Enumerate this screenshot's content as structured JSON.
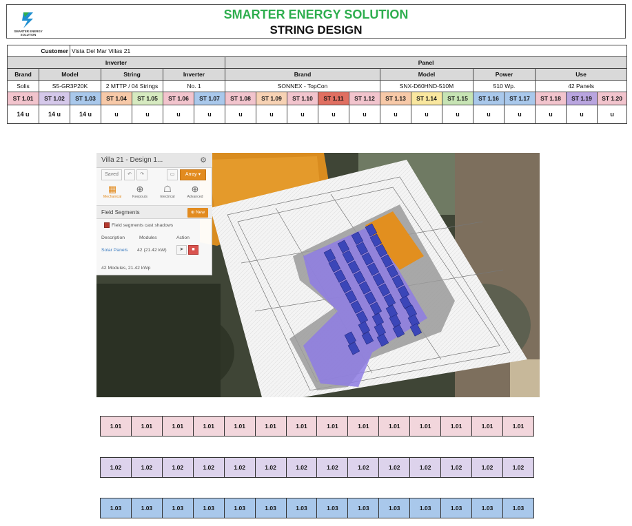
{
  "header": {
    "logo_text": "SMARTER ENERGY SOLUTION",
    "company": "SMARTER ENERGY SOLUTION",
    "title": "STRING DESIGN"
  },
  "customer": {
    "label": "Customer",
    "value": "Vista Del Mar Villas 21"
  },
  "sections": {
    "inverter": "Inverter",
    "panel": "Panel"
  },
  "columns": {
    "brand": "Brand",
    "model": "Model",
    "string": "String",
    "inverter": "Inverter",
    "panel_brand": "Brand",
    "panel_model": "Model",
    "power": "Power",
    "use": "Use"
  },
  "values": {
    "brand": "Solis",
    "model": "S5-GR3P20K",
    "string": "2 MTTP / 04 Strings",
    "inverter": "No. 1",
    "panel_brand": "SONNEX - TopCon",
    "panel_model": "SNX-D60HND-510M",
    "power": "510 Wp.",
    "use": "42 Panels"
  },
  "strings": [
    {
      "label": "ST 1.01",
      "units": "14 u",
      "color": "#f2c4cd"
    },
    {
      "label": "ST 1.02",
      "units": "14 u",
      "color": "#d5c8ea"
    },
    {
      "label": "ST 1.03",
      "units": "14 u",
      "color": "#a9c8eb"
    },
    {
      "label": "ST 1.04",
      "units": "u",
      "color": "#f7c9a8"
    },
    {
      "label": "ST 1.05",
      "units": "u",
      "color": "#d6eac0"
    },
    {
      "label": "ST 1.06",
      "units": "u",
      "color": "#f2c4cd"
    },
    {
      "label": "ST 1.07",
      "units": "u",
      "color": "#a9c8eb"
    },
    {
      "label": "ST 1.08",
      "units": "u",
      "color": "#f2c4cd"
    },
    {
      "label": "ST 1.09",
      "units": "u",
      "color": "#f7d2b4"
    },
    {
      "label": "ST 1.10",
      "units": "u",
      "color": "#f2c4cd"
    },
    {
      "label": "ST 1.11",
      "units": "u",
      "color": "#e06f61"
    },
    {
      "label": "ST 1.12",
      "units": "u",
      "color": "#f2c4cd"
    },
    {
      "label": "ST 1.13",
      "units": "u",
      "color": "#f7c9a8"
    },
    {
      "label": "ST 1.14",
      "units": "u",
      "color": "#f9e79f"
    },
    {
      "label": "ST 1.15",
      "units": "u",
      "color": "#c7e4b4"
    },
    {
      "label": "ST 1.16",
      "units": "u",
      "color": "#a9c8eb"
    },
    {
      "label": "ST 1.17",
      "units": "u",
      "color": "#a9c8eb"
    },
    {
      "label": "ST 1.18",
      "units": "u",
      "color": "#f2c4cd"
    },
    {
      "label": "ST 1.19",
      "units": "u",
      "color": "#b9a5df"
    },
    {
      "label": "ST 1.20",
      "units": "u",
      "color": "#f2c4cd"
    }
  ],
  "app": {
    "title": "Villa 21 - Design 1...",
    "saved": "Saved",
    "undo": "↶",
    "redo": "↷",
    "array": "Array ▾",
    "modes": [
      "Mechanical",
      "Keepouts",
      "Electrical",
      "Advanced"
    ],
    "field_segments": "Field Segments",
    "new": "⊕ New",
    "shadow_label": "Field segments cast shadows",
    "col_description": "Description",
    "col_modules": "Modules",
    "col_action": "Action",
    "segment_name": "Solar Panels",
    "segment_modules": "42 (21.42 kW)",
    "summary": "42 Modules, 21.42 kWp"
  },
  "grids": [
    {
      "label": "1.01",
      "count": 14,
      "color": "#f2d6dc"
    },
    {
      "label": "1.02",
      "count": 14,
      "color": "#ddd3ec"
    },
    {
      "label": "1.03",
      "count": 14,
      "color": "#a9c8eb"
    }
  ]
}
